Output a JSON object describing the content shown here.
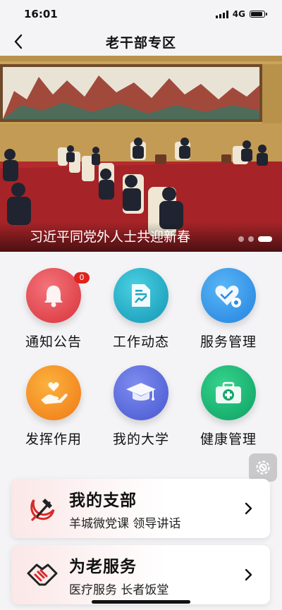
{
  "status": {
    "time": "16:01",
    "network": "4G"
  },
  "nav": {
    "title": "老干部专区"
  },
  "banner": {
    "caption": "习近平同党外人士共迎新春",
    "slide_count": 3,
    "active_slide": 3
  },
  "grid": [
    {
      "label": "通知公告",
      "icon": "bell-icon",
      "badge": "0",
      "color": "#e8454c"
    },
    {
      "label": "工作动态",
      "icon": "document-chart-icon",
      "color": "#19a6c2"
    },
    {
      "label": "服务管理",
      "icon": "heart-gear-icon",
      "color": "#2b8ee8"
    },
    {
      "label": "发挥作用",
      "icon": "hand-heart-icon",
      "color": "#f58a1d"
    },
    {
      "label": "我的大学",
      "icon": "graduation-cap-icon",
      "color": "#5b6ad8"
    },
    {
      "label": "健康管理",
      "icon": "medical-kit-icon",
      "color": "#17b06f"
    }
  ],
  "cards": [
    {
      "title": "我的支部",
      "subtitle": "羊城微党课 领导讲话",
      "icon": "hammer-sickle-icon"
    },
    {
      "title": "为老服务",
      "subtitle": "医疗服务 长者饭堂",
      "icon": "handshake-icon"
    }
  ]
}
